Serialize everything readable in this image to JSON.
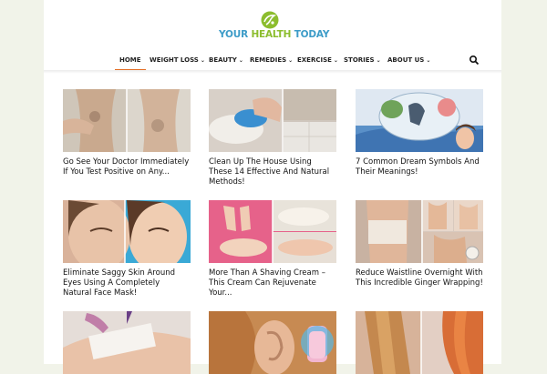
{
  "site": {
    "logo_words": [
      "YOUR",
      "HEALTH",
      "TODAY"
    ]
  },
  "nav": {
    "items": [
      {
        "label": "HOME",
        "has_dropdown": false
      },
      {
        "label": "WEIGHT LOSS",
        "has_dropdown": true
      },
      {
        "label": "BEAUTY",
        "has_dropdown": true
      },
      {
        "label": "REMEDIES",
        "has_dropdown": true
      },
      {
        "label": "EXERCISE",
        "has_dropdown": true
      },
      {
        "label": "STORIES",
        "has_dropdown": true
      },
      {
        "label": "ABOUT US",
        "has_dropdown": true
      }
    ],
    "active": "HOME"
  },
  "articles": [
    {
      "title": "Go See Your Doctor Immediately If You Test Positive on Any..."
    },
    {
      "title": "Clean Up The House Using These 14 Effective And Natural Methods!"
    },
    {
      "title": "7 Common Dream Symbols And Their Meanings!"
    },
    {
      "title": "Eliminate Saggy Skin Around Eyes Using A Completely Natural Face Mask!"
    },
    {
      "title": "More Than A Shaving Cream – This Cream Can Rejuvenate Your..."
    },
    {
      "title": "Reduce Waistline Overnight With This Incredible Ginger Wrapping!"
    },
    {
      "title": ""
    },
    {
      "title": ""
    },
    {
      "title": ""
    }
  ],
  "colors": {
    "accent": "#e36e24",
    "background": "#f1f3e9",
    "logo_blue": "#3d9cc8",
    "logo_green": "#8cbd2e"
  },
  "icons": {
    "search": "search-icon",
    "dropdown": "chevron-down-icon",
    "logo": "leaf-logo-icon"
  }
}
